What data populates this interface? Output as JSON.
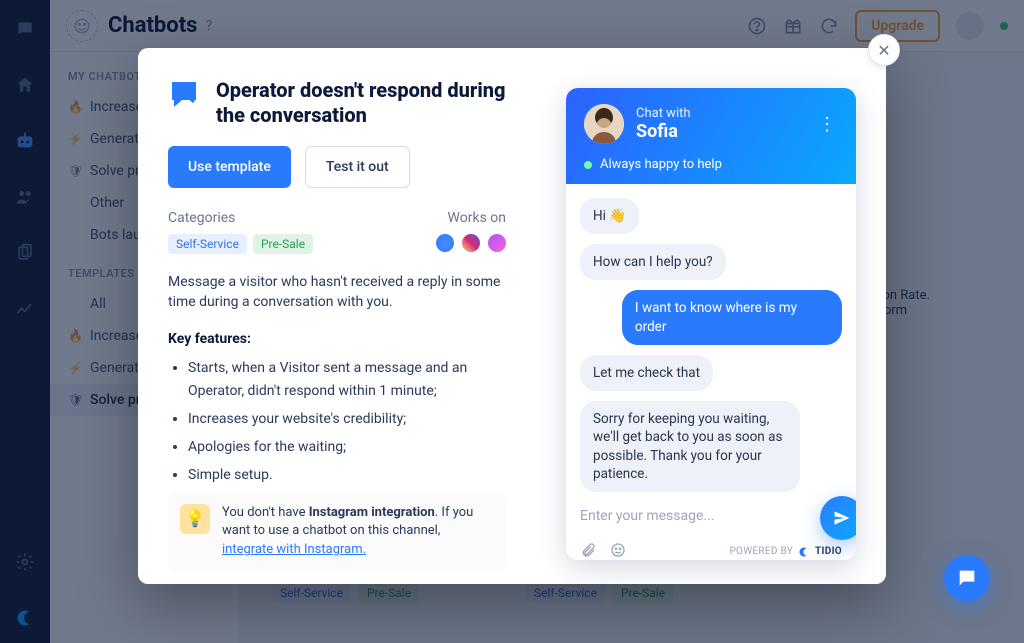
{
  "header": {
    "title": "Chatbots",
    "upgrade": "Upgrade"
  },
  "sidebar": {
    "section1": "MY CHATBOTS",
    "section2": "TEMPLATES",
    "items1": [
      {
        "icon": "🔥",
        "label": "Increase s"
      },
      {
        "icon": "⚡",
        "label": "Generate l"
      },
      {
        "icon": "🛡",
        "label": "Solve prob"
      },
      {
        "icon": "",
        "label": "Other"
      },
      {
        "icon": "",
        "label": "Bots launcher"
      }
    ],
    "items2": [
      {
        "icon": "",
        "label": "All"
      },
      {
        "icon": "🔥",
        "label": "Increase s"
      },
      {
        "icon": "⚡",
        "label": "Generate l"
      },
      {
        "icon": "🛡",
        "label": "Solve prob",
        "active": true
      }
    ]
  },
  "modal": {
    "title": "Operator doesn't respond during the conversation",
    "use_template": "Use template",
    "test": "Test it out",
    "categories_label": "Categories",
    "works_label": "Works on",
    "tags": [
      "Self-Service",
      "Pre-Sale"
    ],
    "description": "Message a visitor who hasn't received a reply in some time during a conversation with you.",
    "key_features_label": "Key features:",
    "key_features": [
      "Starts, when a Visitor sent a message and an Operator, didn't respond within 1 minute;",
      "Increases your website's credibility;",
      "Apologies for the waiting;",
      "Simple setup."
    ],
    "info_pre": "You don't have ",
    "info_bold": "Instagram integration",
    "info_mid": ". If you want to use a chatbot on this channel, ",
    "info_link": "integrate with Instagram."
  },
  "chat": {
    "chat_with": "Chat with",
    "name": "Sofia",
    "status": "Always happy to help",
    "messages": [
      {
        "side": "in",
        "text": "Hi 👋"
      },
      {
        "side": "in",
        "text": "How can I help you?"
      },
      {
        "side": "out",
        "text": "I want to know where is my order"
      },
      {
        "side": "in",
        "text": "Let me check that"
      },
      {
        "side": "in",
        "text": "Sorry for keeping you waiting, we'll get back to you as soon as possible. Thank you for your patience."
      }
    ],
    "placeholder": "Enter your message...",
    "powered": "POWERED BY",
    "brand": "TIDIO"
  },
  "bg": {
    "card_title_suffix": "orm",
    "card_line1_suffix": "Conversion Rate.",
    "card_line2_suffix": "fills in a form",
    "tag1": "Self-Service",
    "tag2": "Pre-Sale"
  }
}
